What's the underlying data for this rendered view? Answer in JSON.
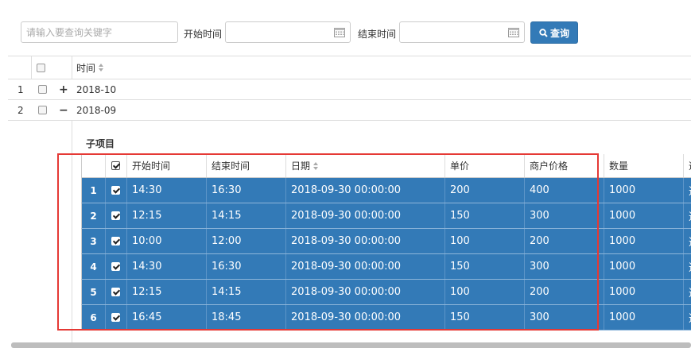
{
  "toolbar": {
    "keyword_placeholder": "请输入要查询关键字",
    "start_label": "开始时间",
    "end_label": "结束时间",
    "search_label": "查询"
  },
  "outer_table": {
    "header_time": "时间",
    "rows": [
      {
        "index": "1",
        "toggle": "+",
        "time": "2018-10"
      },
      {
        "index": "2",
        "toggle": "−",
        "time": "2018-09"
      }
    ]
  },
  "sub_table": {
    "title": "子项目",
    "headers": {
      "start": "开始时间",
      "end": "结束时间",
      "date": "日期",
      "unit_price": "单价",
      "merchant_price": "商户价格",
      "quantity": "数量",
      "extra": "选"
    },
    "rows": [
      {
        "index": "1",
        "start": "14:30",
        "end": "16:30",
        "date": "2018-09-30 00:00:00",
        "unit_price": "200",
        "merchant_price": "400",
        "quantity": "1000",
        "extra": "选"
      },
      {
        "index": "2",
        "start": "12:15",
        "end": "14:15",
        "date": "2018-09-30 00:00:00",
        "unit_price": "150",
        "merchant_price": "300",
        "quantity": "1000",
        "extra": "选"
      },
      {
        "index": "3",
        "start": "10:00",
        "end": "12:00",
        "date": "2018-09-30 00:00:00",
        "unit_price": "100",
        "merchant_price": "200",
        "quantity": "1000",
        "extra": "选"
      },
      {
        "index": "4",
        "start": "14:30",
        "end": "16:30",
        "date": "2018-09-30 00:00:00",
        "unit_price": "150",
        "merchant_price": "300",
        "quantity": "1000",
        "extra": "选"
      },
      {
        "index": "5",
        "start": "12:15",
        "end": "14:15",
        "date": "2018-09-30 00:00:00",
        "unit_price": "100",
        "merchant_price": "200",
        "quantity": "1000",
        "extra": "选"
      },
      {
        "index": "6",
        "start": "16:45",
        "end": "18:45",
        "date": "2018-09-30 00:00:00",
        "unit_price": "150",
        "merchant_price": "300",
        "quantity": "1000",
        "extra": "选"
      }
    ]
  },
  "colors": {
    "selected_row": "#337ab7",
    "button": "#337ab7",
    "highlight_box": "#e53935"
  }
}
